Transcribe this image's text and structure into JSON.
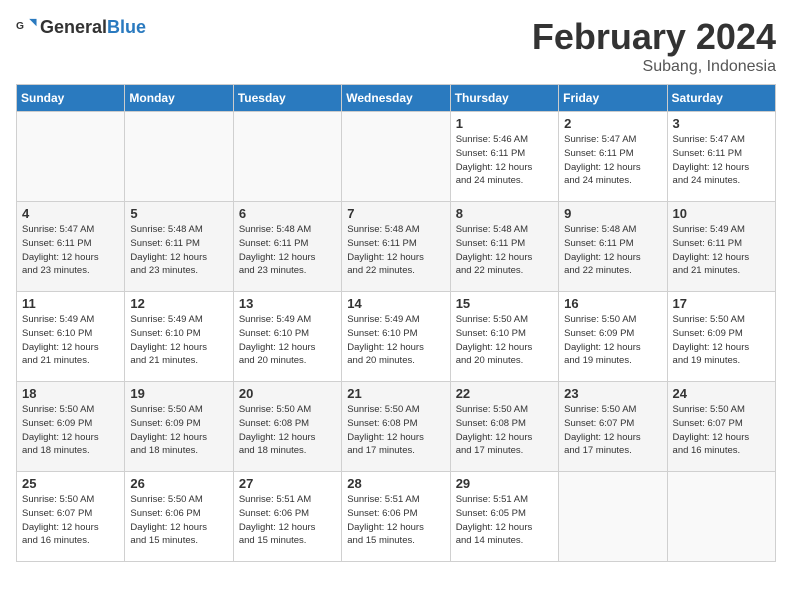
{
  "header": {
    "logo_general": "General",
    "logo_blue": "Blue",
    "month_title": "February 2024",
    "subtitle": "Subang, Indonesia"
  },
  "days_of_week": [
    "Sunday",
    "Monday",
    "Tuesday",
    "Wednesday",
    "Thursday",
    "Friday",
    "Saturday"
  ],
  "weeks": [
    [
      {
        "day": "",
        "info": ""
      },
      {
        "day": "",
        "info": ""
      },
      {
        "day": "",
        "info": ""
      },
      {
        "day": "",
        "info": ""
      },
      {
        "day": "1",
        "info": "Sunrise: 5:46 AM\nSunset: 6:11 PM\nDaylight: 12 hours\nand 24 minutes."
      },
      {
        "day": "2",
        "info": "Sunrise: 5:47 AM\nSunset: 6:11 PM\nDaylight: 12 hours\nand 24 minutes."
      },
      {
        "day": "3",
        "info": "Sunrise: 5:47 AM\nSunset: 6:11 PM\nDaylight: 12 hours\nand 24 minutes."
      }
    ],
    [
      {
        "day": "4",
        "info": "Sunrise: 5:47 AM\nSunset: 6:11 PM\nDaylight: 12 hours\nand 23 minutes."
      },
      {
        "day": "5",
        "info": "Sunrise: 5:48 AM\nSunset: 6:11 PM\nDaylight: 12 hours\nand 23 minutes."
      },
      {
        "day": "6",
        "info": "Sunrise: 5:48 AM\nSunset: 6:11 PM\nDaylight: 12 hours\nand 23 minutes."
      },
      {
        "day": "7",
        "info": "Sunrise: 5:48 AM\nSunset: 6:11 PM\nDaylight: 12 hours\nand 22 minutes."
      },
      {
        "day": "8",
        "info": "Sunrise: 5:48 AM\nSunset: 6:11 PM\nDaylight: 12 hours\nand 22 minutes."
      },
      {
        "day": "9",
        "info": "Sunrise: 5:48 AM\nSunset: 6:11 PM\nDaylight: 12 hours\nand 22 minutes."
      },
      {
        "day": "10",
        "info": "Sunrise: 5:49 AM\nSunset: 6:11 PM\nDaylight: 12 hours\nand 21 minutes."
      }
    ],
    [
      {
        "day": "11",
        "info": "Sunrise: 5:49 AM\nSunset: 6:10 PM\nDaylight: 12 hours\nand 21 minutes."
      },
      {
        "day": "12",
        "info": "Sunrise: 5:49 AM\nSunset: 6:10 PM\nDaylight: 12 hours\nand 21 minutes."
      },
      {
        "day": "13",
        "info": "Sunrise: 5:49 AM\nSunset: 6:10 PM\nDaylight: 12 hours\nand 20 minutes."
      },
      {
        "day": "14",
        "info": "Sunrise: 5:49 AM\nSunset: 6:10 PM\nDaylight: 12 hours\nand 20 minutes."
      },
      {
        "day": "15",
        "info": "Sunrise: 5:50 AM\nSunset: 6:10 PM\nDaylight: 12 hours\nand 20 minutes."
      },
      {
        "day": "16",
        "info": "Sunrise: 5:50 AM\nSunset: 6:09 PM\nDaylight: 12 hours\nand 19 minutes."
      },
      {
        "day": "17",
        "info": "Sunrise: 5:50 AM\nSunset: 6:09 PM\nDaylight: 12 hours\nand 19 minutes."
      }
    ],
    [
      {
        "day": "18",
        "info": "Sunrise: 5:50 AM\nSunset: 6:09 PM\nDaylight: 12 hours\nand 18 minutes."
      },
      {
        "day": "19",
        "info": "Sunrise: 5:50 AM\nSunset: 6:09 PM\nDaylight: 12 hours\nand 18 minutes."
      },
      {
        "day": "20",
        "info": "Sunrise: 5:50 AM\nSunset: 6:08 PM\nDaylight: 12 hours\nand 18 minutes."
      },
      {
        "day": "21",
        "info": "Sunrise: 5:50 AM\nSunset: 6:08 PM\nDaylight: 12 hours\nand 17 minutes."
      },
      {
        "day": "22",
        "info": "Sunrise: 5:50 AM\nSunset: 6:08 PM\nDaylight: 12 hours\nand 17 minutes."
      },
      {
        "day": "23",
        "info": "Sunrise: 5:50 AM\nSunset: 6:07 PM\nDaylight: 12 hours\nand 17 minutes."
      },
      {
        "day": "24",
        "info": "Sunrise: 5:50 AM\nSunset: 6:07 PM\nDaylight: 12 hours\nand 16 minutes."
      }
    ],
    [
      {
        "day": "25",
        "info": "Sunrise: 5:50 AM\nSunset: 6:07 PM\nDaylight: 12 hours\nand 16 minutes."
      },
      {
        "day": "26",
        "info": "Sunrise: 5:50 AM\nSunset: 6:06 PM\nDaylight: 12 hours\nand 15 minutes."
      },
      {
        "day": "27",
        "info": "Sunrise: 5:51 AM\nSunset: 6:06 PM\nDaylight: 12 hours\nand 15 minutes."
      },
      {
        "day": "28",
        "info": "Sunrise: 5:51 AM\nSunset: 6:06 PM\nDaylight: 12 hours\nand 15 minutes."
      },
      {
        "day": "29",
        "info": "Sunrise: 5:51 AM\nSunset: 6:05 PM\nDaylight: 12 hours\nand 14 minutes."
      },
      {
        "day": "",
        "info": ""
      },
      {
        "day": "",
        "info": ""
      }
    ]
  ]
}
